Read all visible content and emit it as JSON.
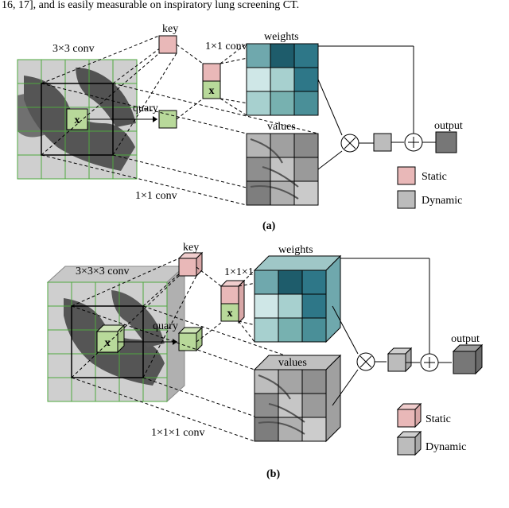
{
  "topText": "16, 17], and is easily measurable on inspiratory lung screening CT.",
  "a": {
    "key": "key",
    "conv3": "3×3 conv",
    "quary": "quary",
    "conv1": "1×1 conv",
    "conv1x1_top": "1×1 conv",
    "weights": "weights",
    "values": "values",
    "x1": "x",
    "x2": "x",
    "output": "output",
    "static": "Static",
    "dynamic": "Dynamic",
    "caption": "(a)"
  },
  "b": {
    "key": "key",
    "conv3": "3×3×3 conv",
    "quary": "quary",
    "conv1": "1×1×1 conv",
    "conv1x1_top": "1×1×1 conv",
    "weights": "weights",
    "values": "values",
    "x1": "x",
    "x2": "x",
    "output": "output",
    "static": "Static",
    "dynamic": "Dynamic",
    "caption": "(b)"
  },
  "chart_data": null
}
